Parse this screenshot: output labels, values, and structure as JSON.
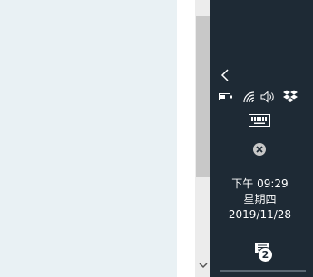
{
  "tray": {
    "icons": [
      "chevron-left-icon",
      "battery-icon",
      "wifi-icon",
      "speaker-icon",
      "dropbox-icon",
      "keyboard-icon",
      "close-circle-icon",
      "notification-icon"
    ],
    "notification_count": "2"
  },
  "clock": {
    "time": "下午 09:29",
    "weekday": "星期四",
    "date": "2019/11/28"
  },
  "colors": {
    "taskbar_bg": "#1e2a35",
    "content_bg": "#e9f1f4",
    "scroll_thumb": "#c8c8c8"
  }
}
